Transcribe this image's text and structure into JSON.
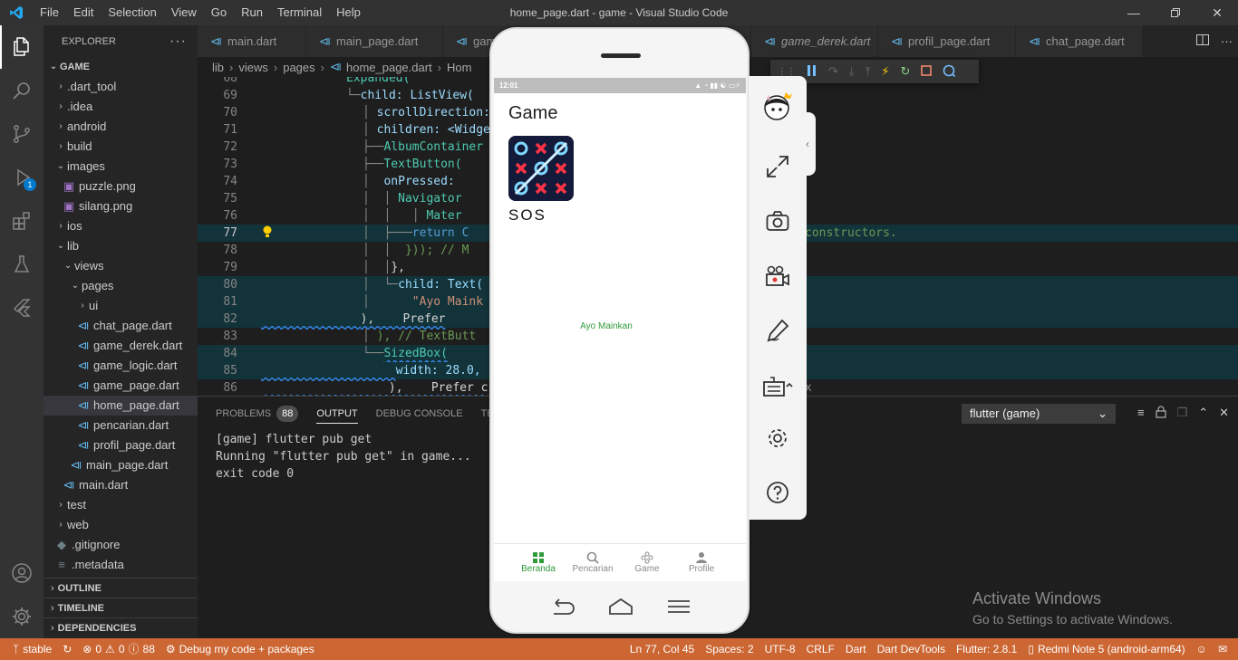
{
  "window": {
    "title": "home_page.dart - game - Visual Studio Code",
    "menu": [
      "File",
      "Edit",
      "Selection",
      "View",
      "Go",
      "Run",
      "Terminal",
      "Help"
    ]
  },
  "activity": {
    "debug_badge": "1"
  },
  "explorer": {
    "header": "EXPLORER",
    "root": "GAME",
    "items": [
      {
        "label": ".dart_tool",
        "type": "folder"
      },
      {
        "label": ".idea",
        "type": "folder"
      },
      {
        "label": "android",
        "type": "folder"
      },
      {
        "label": "build",
        "type": "folder"
      },
      {
        "label": "images",
        "type": "folder-open"
      },
      {
        "label": "puzzle.png",
        "type": "image"
      },
      {
        "label": "silang.png",
        "type": "image"
      },
      {
        "label": "ios",
        "type": "folder"
      },
      {
        "label": "lib",
        "type": "folder-open"
      },
      {
        "label": "views",
        "type": "folder-open"
      },
      {
        "label": "pages",
        "type": "folder-open"
      },
      {
        "label": "ui",
        "type": "folder"
      },
      {
        "label": "chat_page.dart",
        "type": "dart"
      },
      {
        "label": "game_derek.dart",
        "type": "dart"
      },
      {
        "label": "game_logic.dart",
        "type": "dart"
      },
      {
        "label": "game_page.dart",
        "type": "dart"
      },
      {
        "label": "home_page.dart",
        "type": "dart"
      },
      {
        "label": "pencarian.dart",
        "type": "dart"
      },
      {
        "label": "profil_page.dart",
        "type": "dart"
      },
      {
        "label": "main_page.dart",
        "type": "dart"
      },
      {
        "label": "main.dart",
        "type": "dart"
      },
      {
        "label": "test",
        "type": "folder"
      },
      {
        "label": "web",
        "type": "folder"
      },
      {
        "label": ".gitignore",
        "type": "git"
      },
      {
        "label": ".metadata",
        "type": "meta"
      }
    ],
    "sections": [
      "OUTLINE",
      "TIMELINE",
      "DEPENDENCIES"
    ]
  },
  "tabs": [
    {
      "label": "main.dart"
    },
    {
      "label": "main_page.dart"
    },
    {
      "label": "gam"
    },
    {
      "label": "game_derek.dart"
    },
    {
      "label": "profil_page.dart"
    },
    {
      "label": "chat_page.dart"
    }
  ],
  "breadcrumb": [
    "lib",
    "views",
    "pages",
    "home_page.dart",
    "Hom"
  ],
  "code": {
    "numbers": [
      "68",
      "69",
      "70",
      "71",
      "72",
      "73",
      "74",
      "75",
      "76",
      "77",
      "78",
      "79",
      "80",
      "81",
      "82",
      "83",
      "84",
      "85",
      "86"
    ],
    "lines": [
      "Expanded(",
      "child: ListView(",
      "scrollDirection:",
      "children: <Widge",
      "AlbumContainer",
      "TextButton(",
      "onPressed:",
      "Navigator",
      "Mater",
      "return C",
      "})); // M",
      "},",
      "child: Text(",
      "\"Ayo Maink",
      "),    Prefer",
      "), // TextButt",
      "SizedBox(",
      "width: 28.0,",
      "),    Prefer c"
    ],
    "overflow_77": "constructors.",
    "overflow_86": "x"
  },
  "panel": {
    "tabs": [
      "PROBLEMS",
      "OUTPUT",
      "DEBUG CONSOLE",
      "TE"
    ],
    "problems_count": "88",
    "channel": "flutter (game)",
    "output": [
      "[game] flutter pub get",
      "Running \"flutter pub get\" in game...",
      "exit code 0"
    ]
  },
  "watermark": {
    "line1": "Activate Windows",
    "line2": "Go to Settings to activate Windows."
  },
  "statusbar": {
    "branch": "stable",
    "errors": "0",
    "warnings": "0",
    "info": "88",
    "debug": "Debug my code + packages",
    "position": "Ln 77, Col 45",
    "spaces": "Spaces: 2",
    "encoding": "UTF-8",
    "eol": "CRLF",
    "language": "Dart",
    "devtools": "Dart DevTools",
    "flutter": "Flutter: 2.8.1",
    "device": "Redmi Note 5 (android-arm64)"
  },
  "phone": {
    "time": "12:01",
    "app_title": "Game",
    "game_name": "SOS",
    "link_text": "Ayo Mainkan",
    "nav": [
      {
        "label": "Beranda",
        "icon": "grid-icon",
        "active": true
      },
      {
        "label": "Pencarian",
        "icon": "search-icon",
        "active": false
      },
      {
        "label": "Game",
        "icon": "gamepad-icon",
        "active": false
      },
      {
        "label": "Profile",
        "icon": "person-icon",
        "active": false
      }
    ]
  },
  "colors": {
    "statusbar": "#cc6633",
    "accent": "#007acc",
    "app_green": "#2e9b3b"
  }
}
